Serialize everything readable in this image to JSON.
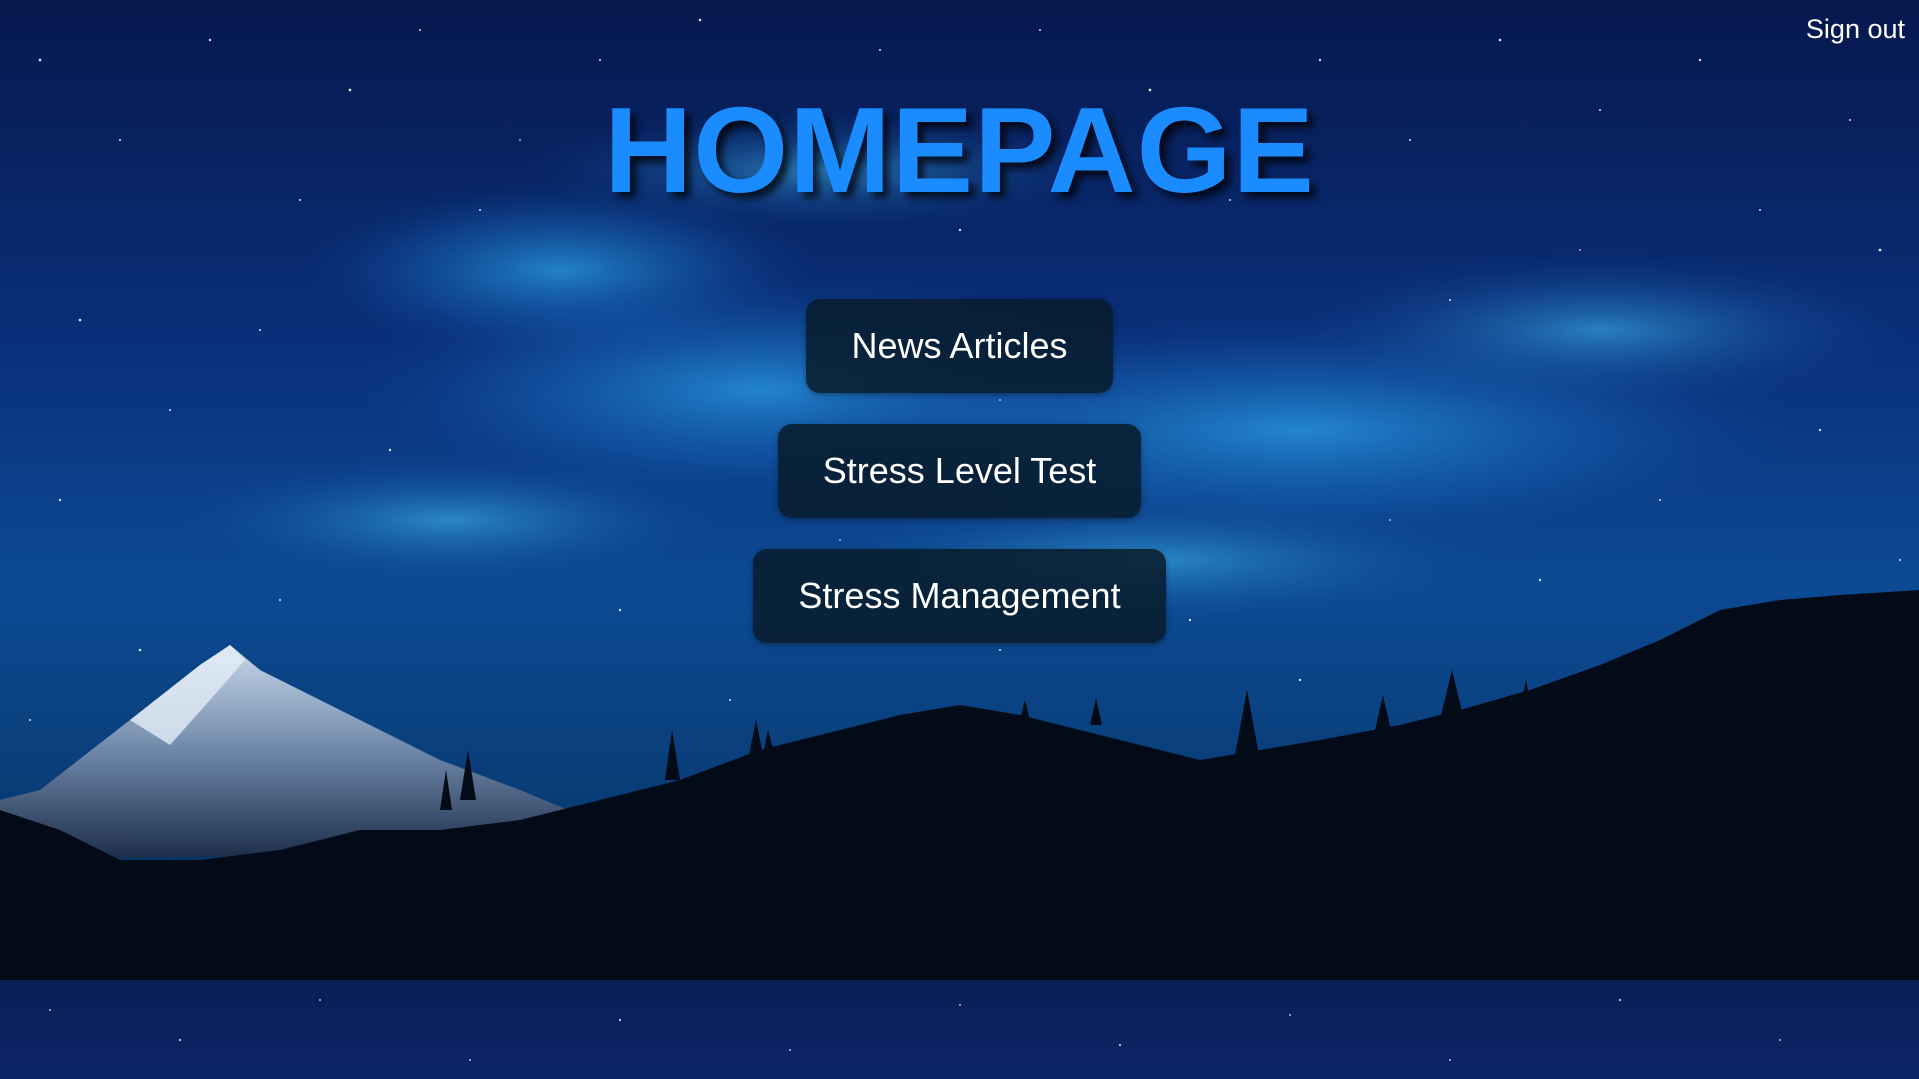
{
  "header": {
    "sign_out_label": "Sign out"
  },
  "main": {
    "title": "HOMEPAGE",
    "buttons": [
      {
        "label": "News Articles"
      },
      {
        "label": "Stress Level Test"
      },
      {
        "label": "Stress Management"
      }
    ]
  },
  "colors": {
    "title": "#1a8cff",
    "button_bg": "#081c2d",
    "button_text": "#ffffff",
    "link_text": "#ffffff"
  }
}
